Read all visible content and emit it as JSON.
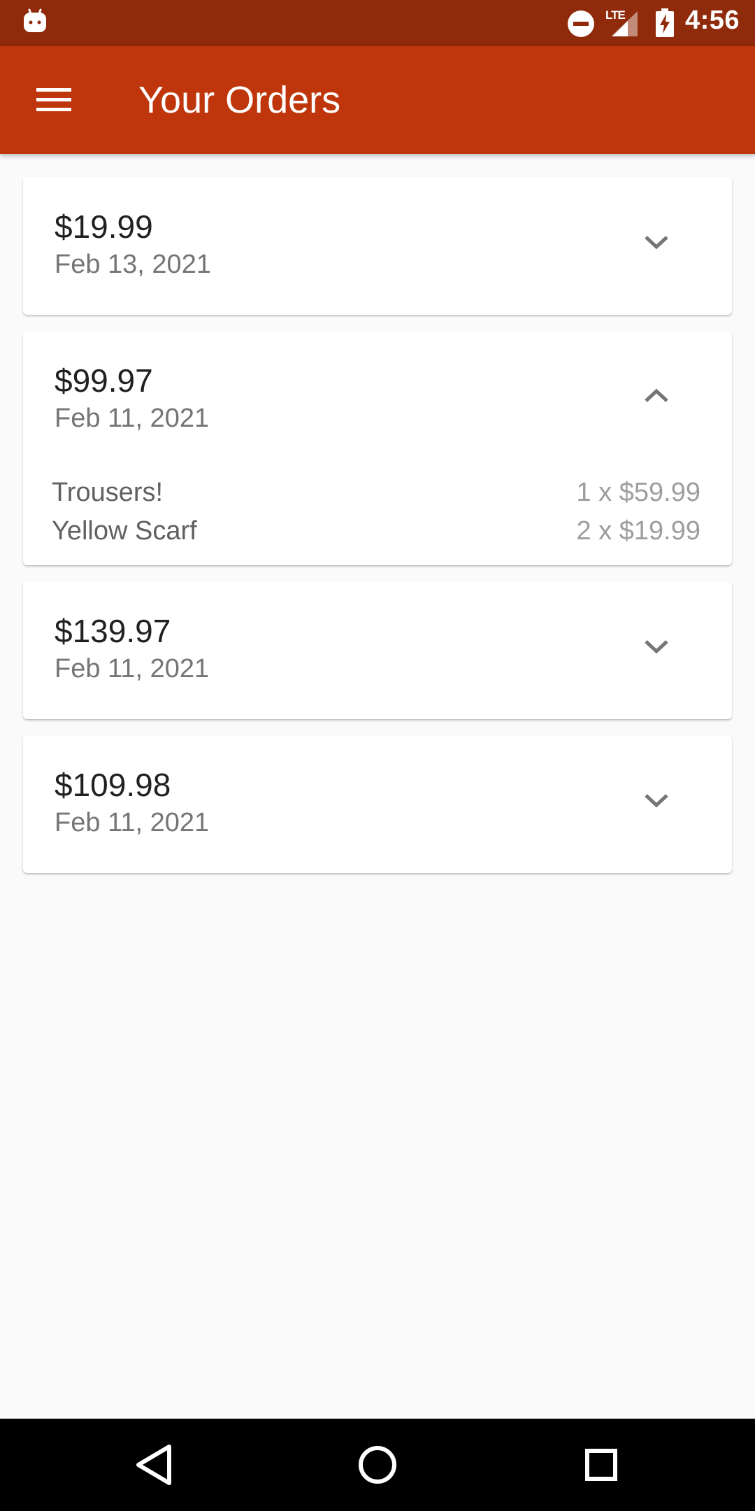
{
  "status_bar": {
    "app_icon": "android-robot-icon",
    "dnd_icon": "do-not-disturb-icon",
    "network_label": "LTE",
    "signal_icon": "signal-icon",
    "battery_icon": "battery-charging-icon",
    "time": "4:56"
  },
  "app_bar": {
    "menu_icon": "hamburger-menu-icon",
    "title": "Your Orders",
    "color": "#bf360c"
  },
  "orders": [
    {
      "total": "$19.99",
      "date": "Feb 13, 2021",
      "expanded": false,
      "items": []
    },
    {
      "total": "$99.97",
      "date": "Feb 11, 2021",
      "expanded": true,
      "items": [
        {
          "name": "Trousers!",
          "qty_price": "1 x $59.99"
        },
        {
          "name": "Yellow Scarf",
          "qty_price": "2 x $19.99"
        }
      ]
    },
    {
      "total": "$139.97",
      "date": "Feb 11, 2021",
      "expanded": false,
      "items": []
    },
    {
      "total": "$109.98",
      "date": "Feb 11, 2021",
      "expanded": false,
      "items": []
    }
  ],
  "nav_bar": {
    "back_icon": "back-triangle-icon",
    "home_icon": "home-circle-icon",
    "recents_icon": "recents-square-icon"
  }
}
